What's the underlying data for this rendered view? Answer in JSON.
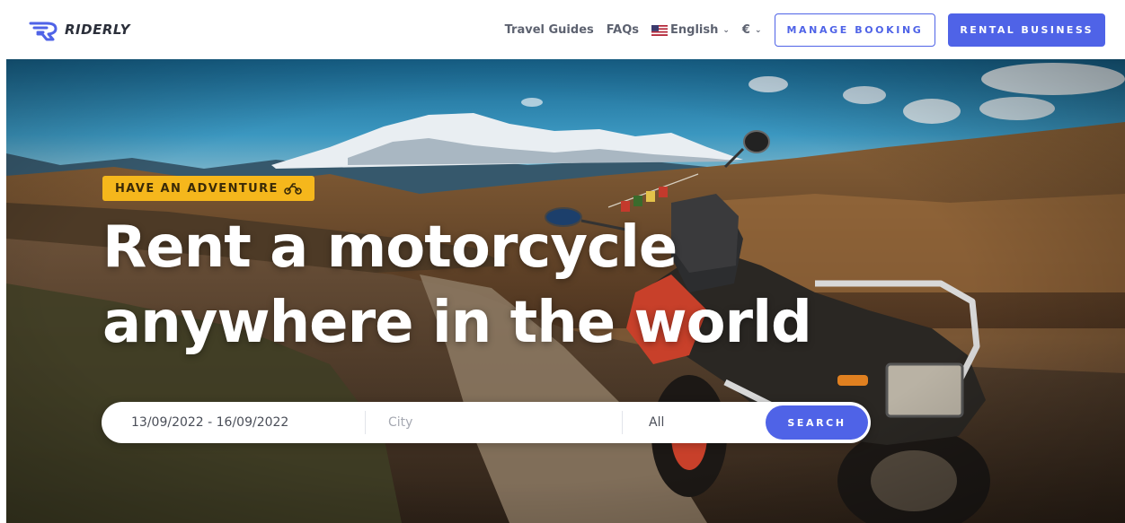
{
  "brand": {
    "name": "RIDERLY",
    "color": "#4f63e7"
  },
  "nav": {
    "travel_guides": "Travel Guides",
    "faqs": "FAQs",
    "language": "English",
    "currency": "€",
    "manage_booking": "MANAGE BOOKING",
    "rental_business": "RENTAL BUSINESS"
  },
  "hero": {
    "badge": "HAVE AN ADVENTURE",
    "headline_line1": "Rent a motorcycle",
    "headline_line2": "anywhere in the world"
  },
  "search": {
    "dates": "13/09/2022 - 16/09/2022",
    "city_placeholder": "City",
    "type": "All",
    "button": "SEARCH"
  },
  "icons": {
    "logo": "riderly-logo-icon",
    "flag": "us-flag-icon",
    "chevron": "chevron-down-icon",
    "badge": "motorcycle-icon"
  },
  "colors": {
    "accent": "#4f63e7",
    "badge": "#f5b71c",
    "nav_text": "#5d6270"
  }
}
